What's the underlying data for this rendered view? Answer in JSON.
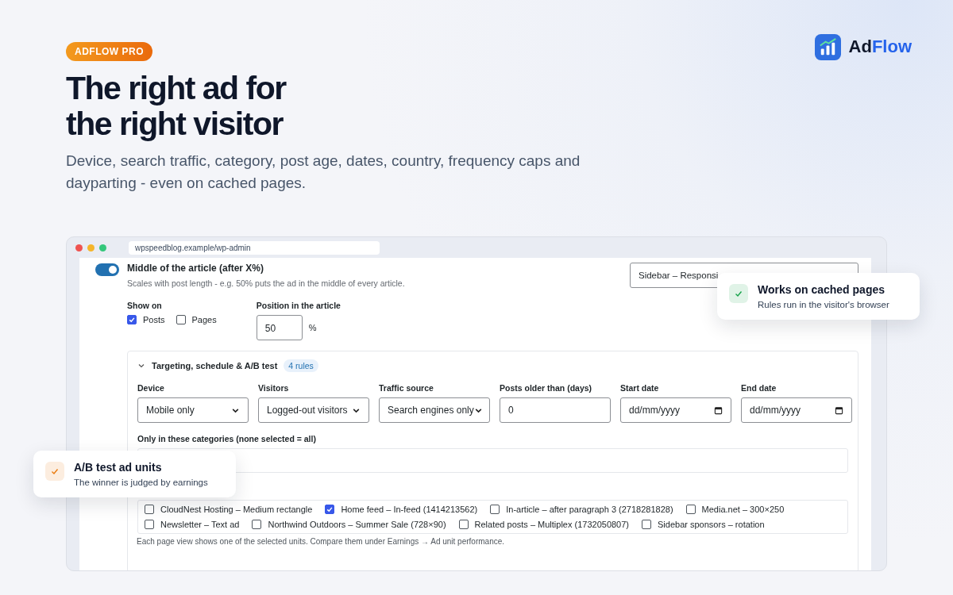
{
  "badge": "ADFLOW PRO",
  "brand": {
    "part_1": "Ad",
    "part_2": "Flow"
  },
  "headline": [
    "The right ad for",
    "the right visitor"
  ],
  "subtitle": "Device, search traffic, category, post age, dates, country, frequency caps and dayparting - even on cached pages.",
  "browser": {
    "url": "wpspeedblog.example/wp-admin"
  },
  "placement": {
    "on": true,
    "title": "Middle of the article (after X%)",
    "description": "Scales with post length - e.g. 50% puts the ad in the middle of every article.",
    "select_value": "Sidebar – Responsi",
    "show_on": {
      "label": "Show on",
      "options": [
        {
          "label": "Posts",
          "checked": true
        },
        {
          "label": "Pages",
          "checked": false
        }
      ]
    },
    "position": {
      "label": "Position in the article",
      "value": "50",
      "unit": "%"
    }
  },
  "targeting": {
    "expanded": true,
    "title": "Targeting, schedule & A/B test",
    "badge": "4 rules",
    "fields": [
      {
        "kind": "select",
        "label": "Device",
        "value": "Mobile only"
      },
      {
        "kind": "select",
        "label": "Visitors",
        "value": "Logged-out visitors"
      },
      {
        "kind": "select",
        "label": "Traffic source",
        "value": "Search engines only"
      },
      {
        "kind": "number",
        "label": "Posts older than (days)",
        "value": "0"
      },
      {
        "kind": "date",
        "label": "Start date",
        "placeholder": "dd/mm/yyyy"
      },
      {
        "kind": "date",
        "label": "End date",
        "placeholder": "dd/mm/yyyy"
      }
    ],
    "categories_label": "Only in these categories (none selected = all)",
    "ad_units": [
      {
        "label": "CloudNest Hosting – Medium rectangle",
        "checked": false
      },
      {
        "label": "Home feed – In-feed (1414213562)",
        "checked": true
      },
      {
        "label": "In-article – after paragraph 3 (2718281828)",
        "checked": false
      },
      {
        "label": "Media.net – 300×250",
        "checked": false
      },
      {
        "label": "Newsletter – Text ad",
        "checked": false
      },
      {
        "label": "Northwind Outdoors – Summer Sale (728×90)",
        "checked": false
      },
      {
        "label": "Related posts – Multiplex (1732050807)",
        "checked": false
      },
      {
        "label": "Sidebar sponsors – rotation",
        "checked": false
      }
    ],
    "ad_units_note": "Each page view shows one of the selected units. Compare them under Earnings → Ad unit performance."
  },
  "cards": [
    {
      "title": "Works on cached pages",
      "subtitle": "Rules run in the visitor's browser",
      "color": "#16a34a"
    },
    {
      "title": "A/B test ad units",
      "subtitle": "The winner is judged by earnings",
      "color": "#ea7a0c"
    }
  ]
}
